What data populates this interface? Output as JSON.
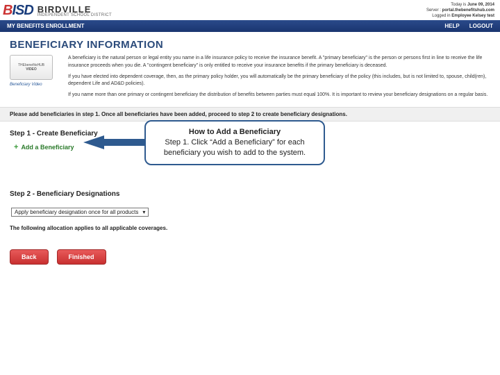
{
  "session": {
    "date_label": "Today is",
    "date_value": "June 09, 2014",
    "server_label": "Server :",
    "server_value": "portal.thebenefitshub.com",
    "logged_label": "Logged in",
    "logged_value": "Employee Kelsey test"
  },
  "logo": {
    "bisd": "BISD",
    "birdville": "BIRDVILLE",
    "birdville_sub": "INDEPENDENT SCHOOL DISTRICT"
  },
  "nav": {
    "left": "MY BENEFITS ENROLLMENT",
    "help": "HELP",
    "logout": "LOGOUT"
  },
  "page": {
    "title": "BENEFICIARY INFORMATION",
    "video_top": "THEbenefitsHUB",
    "video_bottom": "VIDEO",
    "video_caption": "Beneficiary Video"
  },
  "intro": {
    "p1": "A beneficiary is the natural person or legal entity you name in a life insurance policy to receive the insurance benefit. A \"primary beneficiary\" is the person or persons first in line to receive the life insurance proceeds when you die. A \"contingent beneficiary\" is only entitled to receive your insurance benefits if the primary beneficiary is deceased.",
    "p2": "If you have elected into dependent coverage, then, as the primary policy holder, you will automatically be the primary beneficiary of the policy (this includes, but is not limited to, spouse, child(ren), dependent Life and AD&D policies).",
    "p3": "If you name more than one primary or contingent beneficiary the distribution of benefits between parties must equal 100%. It is important to review your beneficiary designations on a regular basis."
  },
  "bar": "Please add beneficiaries in step 1. Once all beneficiaries have been added, proceed to step 2 to create beneficiary designations.",
  "step1": {
    "heading": "Step 1 - Create Beneficiary",
    "add_label": "Add a Beneficiary"
  },
  "callout": {
    "title": "How to Add a Beneficiary",
    "body": "Step 1. Click “Add a Beneficiary” for each beneficiary you wish to add to the system."
  },
  "step2": {
    "heading": "Step 2 - Beneficiary Designations",
    "select_value": "Apply beneficiary designation once for all products",
    "alloc_note": "The following allocation applies to all applicable coverages."
  },
  "buttons": {
    "back": "Back",
    "finished": "Finished"
  }
}
